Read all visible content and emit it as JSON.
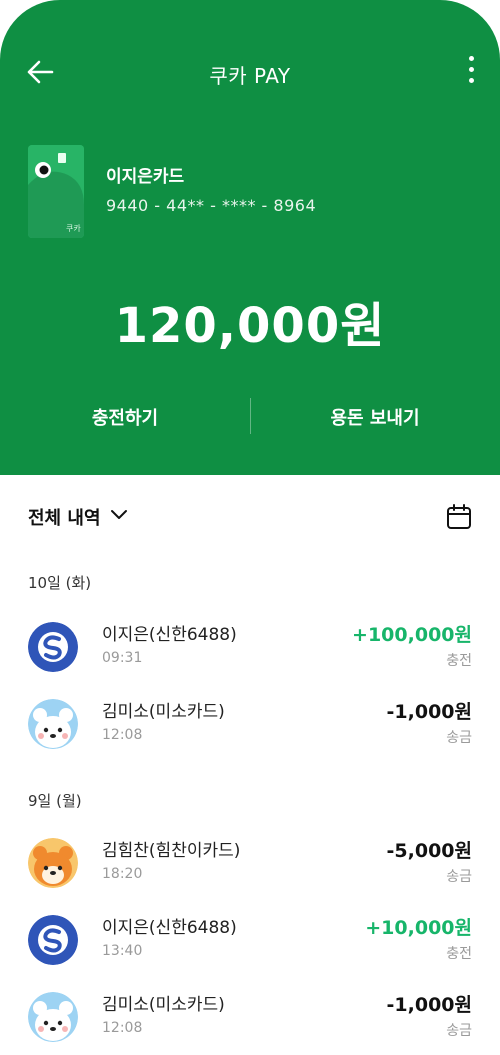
{
  "header": {
    "title": "쿠카 PAY"
  },
  "card": {
    "name": "이지은카드",
    "number": "9440 - 44** - **** - 8964"
  },
  "balance": {
    "amount": "120,000원"
  },
  "actions": {
    "charge": "충전하기",
    "send": "용돈 보내기"
  },
  "history": {
    "filter_label": "전체 내역"
  },
  "groups": [
    {
      "date": "10일 (화)"
    },
    {
      "date": "9일 (월)"
    }
  ],
  "transactions": [
    {
      "name": "이지은(신한6488)",
      "time": "09:31",
      "amount": "+100,000원",
      "type": "충전",
      "avatar": "shinhan-logo"
    },
    {
      "name": "김미소(미소카드)",
      "time": "12:08",
      "amount": "-1,000원",
      "type": "송금",
      "avatar": "white-bear"
    },
    {
      "name": "김힘찬(힘찬이카드)",
      "time": "18:20",
      "amount": "-5,000원",
      "type": "송금",
      "avatar": "orange-bear"
    },
    {
      "name": "이지은(신한6488)",
      "time": "13:40",
      "amount": "+10,000원",
      "type": "충전",
      "avatar": "shinhan-logo"
    },
    {
      "name": "김미소(미소카드)",
      "time": "12:08",
      "amount": "-1,000원",
      "type": "송금",
      "avatar": "white-bear"
    }
  ],
  "colors": {
    "brand_green": "#0f8f43",
    "plus_green": "#17b56a",
    "shinhan_blue": "#2f55b8"
  }
}
